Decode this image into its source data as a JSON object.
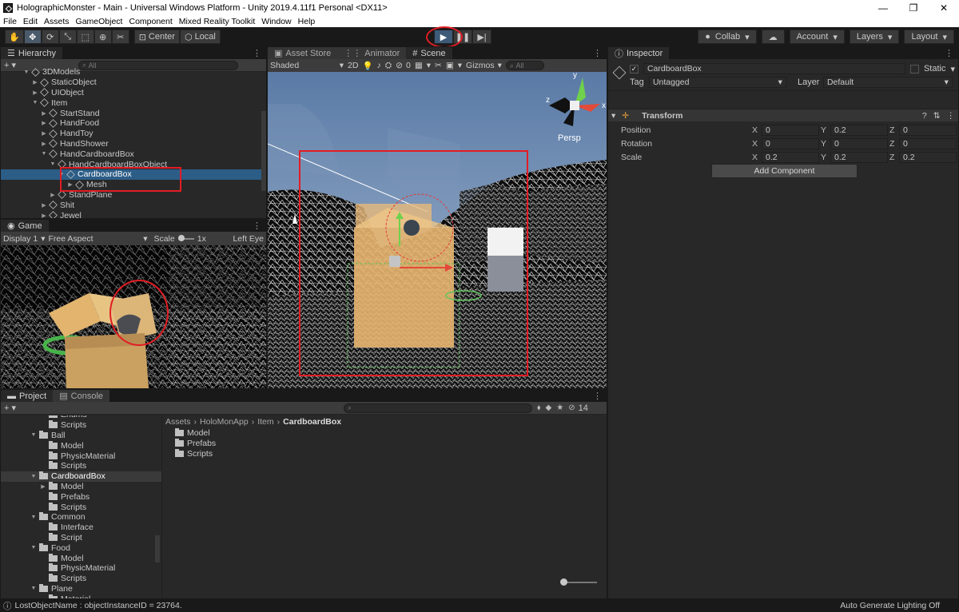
{
  "window": {
    "title": "HolographicMonster - Main - Universal Windows Platform - Unity 2019.4.11f1 Personal <DX11>"
  },
  "menu": [
    "File",
    "Edit",
    "Assets",
    "GameObject",
    "Component",
    "Mixed Reality Toolkit",
    "Window",
    "Help"
  ],
  "toolbar": {
    "center_label": "Center",
    "local_label": "Local",
    "collab_label": "Collab",
    "account_label": "Account",
    "layers_label": "Layers",
    "layout_label": "Layout"
  },
  "hierarchy": {
    "tab": "Hierarchy",
    "search_placeholder": "All",
    "rows": [
      {
        "label": "3DModels",
        "indent": 1,
        "expanded": true
      },
      {
        "label": "StaticObject",
        "indent": 2,
        "expanded": false
      },
      {
        "label": "UIObject",
        "indent": 2,
        "expanded": false
      },
      {
        "label": "Item",
        "indent": 2,
        "expanded": true
      },
      {
        "label": "StartStand",
        "indent": 3,
        "expanded": false
      },
      {
        "label": "HandFood",
        "indent": 3,
        "expanded": false
      },
      {
        "label": "HandToy",
        "indent": 3,
        "expanded": false
      },
      {
        "label": "HandShower",
        "indent": 3,
        "expanded": false
      },
      {
        "label": "HandCardboardBox",
        "indent": 3,
        "expanded": true
      },
      {
        "label": "HandCardboardBoxObject",
        "indent": 4,
        "expanded": true
      },
      {
        "label": "CardboardBox",
        "indent": 5,
        "expanded": true,
        "selected": true
      },
      {
        "label": "Mesh",
        "indent": 6,
        "expanded": false
      },
      {
        "label": "StandPlane",
        "indent": 4,
        "expanded": false
      },
      {
        "label": "Shit",
        "indent": 3,
        "expanded": false
      },
      {
        "label": "Jewel",
        "indent": 3,
        "expanded": false
      }
    ]
  },
  "game": {
    "tab": "Game",
    "display": "Display 1",
    "aspect": "Free Aspect",
    "scale_label": "Scale",
    "scale_value": "1x",
    "eye": "Left Eye"
  },
  "scene": {
    "tabs": [
      "Asset Store",
      "Animator",
      "Scene"
    ],
    "shading": "Shaded",
    "mode_2d": "2D",
    "fx_count": "0",
    "gizmos": "Gizmos",
    "search_placeholder": "All",
    "persp": "Persp",
    "axis_y": "y",
    "axis_x": "x",
    "axis_z": "z"
  },
  "inspector": {
    "tab": "Inspector",
    "object_name": "CardboardBox",
    "static_label": "Static",
    "tag_label": "Tag",
    "tag_value": "Untagged",
    "layer_label": "Layer",
    "layer_value": "Default",
    "transform_title": "Transform",
    "properties": [
      {
        "label": "Position",
        "x": "0",
        "y": "0.2",
        "z": "0"
      },
      {
        "label": "Rotation",
        "x": "0",
        "y": "0",
        "z": "0"
      },
      {
        "label": "Scale",
        "x": "0.2",
        "y": "0.2",
        "z": "0.2"
      }
    ],
    "add_component": "Add Component"
  },
  "project": {
    "tabs": [
      "Project",
      "Console"
    ],
    "hidden_count": "14",
    "tree": [
      {
        "label": "Enums",
        "indent": 3
      },
      {
        "label": "Scripts",
        "indent": 3
      },
      {
        "label": "Ball",
        "indent": 2,
        "expanded": true
      },
      {
        "label": "Model",
        "indent": 3
      },
      {
        "label": "PhysicMaterial",
        "indent": 3
      },
      {
        "label": "Scripts",
        "indent": 3
      },
      {
        "label": "CardboardBox",
        "indent": 2,
        "expanded": true,
        "selected": true
      },
      {
        "label": "Model",
        "indent": 3,
        "expandable": true
      },
      {
        "label": "Prefabs",
        "indent": 3
      },
      {
        "label": "Scripts",
        "indent": 3
      },
      {
        "label": "Common",
        "indent": 2,
        "expanded": true
      },
      {
        "label": "Interface",
        "indent": 3
      },
      {
        "label": "Script",
        "indent": 3
      },
      {
        "label": "Food",
        "indent": 2,
        "expanded": true
      },
      {
        "label": "Model",
        "indent": 3
      },
      {
        "label": "PhysicMaterial",
        "indent": 3
      },
      {
        "label": "Scripts",
        "indent": 3
      },
      {
        "label": "Plane",
        "indent": 2,
        "expanded": true
      },
      {
        "label": "Material",
        "indent": 3
      }
    ],
    "breadcrumb": [
      "Assets",
      "HoloMonApp",
      "Item",
      "CardboardBox"
    ],
    "files": [
      "Model",
      "Prefabs",
      "Scripts"
    ]
  },
  "status": {
    "message": "LostObjectName : objectInstanceID = 23764.",
    "right": "Auto Generate Lighting Off"
  },
  "colors": {
    "selection": "#2c5d87",
    "annotation": "#e21d24",
    "play_active": "#3d5a78"
  }
}
